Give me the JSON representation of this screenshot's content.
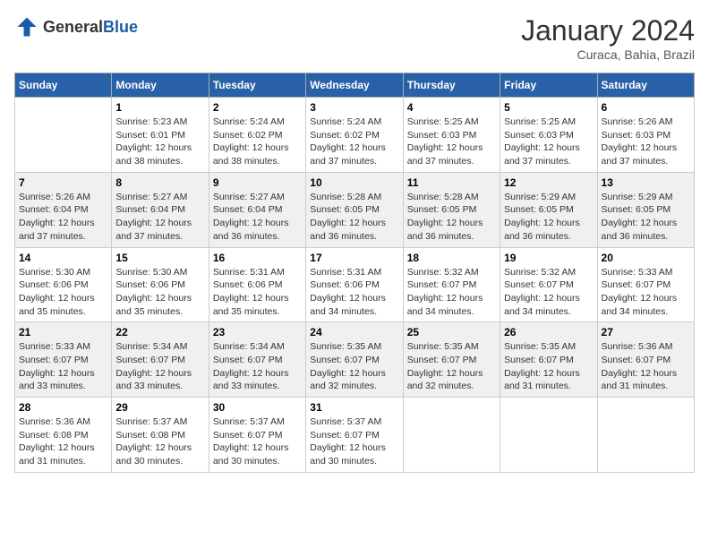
{
  "header": {
    "logo": {
      "general": "General",
      "blue": "Blue"
    },
    "title": "January 2024",
    "location": "Curaca, Bahia, Brazil"
  },
  "days_of_week": [
    "Sunday",
    "Monday",
    "Tuesday",
    "Wednesday",
    "Thursday",
    "Friday",
    "Saturday"
  ],
  "weeks": [
    [
      {
        "day": "",
        "content": ""
      },
      {
        "day": "1",
        "content": "Sunrise: 5:23 AM\nSunset: 6:01 PM\nDaylight: 12 hours\nand 38 minutes."
      },
      {
        "day": "2",
        "content": "Sunrise: 5:24 AM\nSunset: 6:02 PM\nDaylight: 12 hours\nand 38 minutes."
      },
      {
        "day": "3",
        "content": "Sunrise: 5:24 AM\nSunset: 6:02 PM\nDaylight: 12 hours\nand 37 minutes."
      },
      {
        "day": "4",
        "content": "Sunrise: 5:25 AM\nSunset: 6:03 PM\nDaylight: 12 hours\nand 37 minutes."
      },
      {
        "day": "5",
        "content": "Sunrise: 5:25 AM\nSunset: 6:03 PM\nDaylight: 12 hours\nand 37 minutes."
      },
      {
        "day": "6",
        "content": "Sunrise: 5:26 AM\nSunset: 6:03 PM\nDaylight: 12 hours\nand 37 minutes."
      }
    ],
    [
      {
        "day": "7",
        "content": "Sunrise: 5:26 AM\nSunset: 6:04 PM\nDaylight: 12 hours\nand 37 minutes."
      },
      {
        "day": "8",
        "content": "Sunrise: 5:27 AM\nSunset: 6:04 PM\nDaylight: 12 hours\nand 37 minutes."
      },
      {
        "day": "9",
        "content": "Sunrise: 5:27 AM\nSunset: 6:04 PM\nDaylight: 12 hours\nand 36 minutes."
      },
      {
        "day": "10",
        "content": "Sunrise: 5:28 AM\nSunset: 6:05 PM\nDaylight: 12 hours\nand 36 minutes."
      },
      {
        "day": "11",
        "content": "Sunrise: 5:28 AM\nSunset: 6:05 PM\nDaylight: 12 hours\nand 36 minutes."
      },
      {
        "day": "12",
        "content": "Sunrise: 5:29 AM\nSunset: 6:05 PM\nDaylight: 12 hours\nand 36 minutes."
      },
      {
        "day": "13",
        "content": "Sunrise: 5:29 AM\nSunset: 6:05 PM\nDaylight: 12 hours\nand 36 minutes."
      }
    ],
    [
      {
        "day": "14",
        "content": "Sunrise: 5:30 AM\nSunset: 6:06 PM\nDaylight: 12 hours\nand 35 minutes."
      },
      {
        "day": "15",
        "content": "Sunrise: 5:30 AM\nSunset: 6:06 PM\nDaylight: 12 hours\nand 35 minutes."
      },
      {
        "day": "16",
        "content": "Sunrise: 5:31 AM\nSunset: 6:06 PM\nDaylight: 12 hours\nand 35 minutes."
      },
      {
        "day": "17",
        "content": "Sunrise: 5:31 AM\nSunset: 6:06 PM\nDaylight: 12 hours\nand 34 minutes."
      },
      {
        "day": "18",
        "content": "Sunrise: 5:32 AM\nSunset: 6:07 PM\nDaylight: 12 hours\nand 34 minutes."
      },
      {
        "day": "19",
        "content": "Sunrise: 5:32 AM\nSunset: 6:07 PM\nDaylight: 12 hours\nand 34 minutes."
      },
      {
        "day": "20",
        "content": "Sunrise: 5:33 AM\nSunset: 6:07 PM\nDaylight: 12 hours\nand 34 minutes."
      }
    ],
    [
      {
        "day": "21",
        "content": "Sunrise: 5:33 AM\nSunset: 6:07 PM\nDaylight: 12 hours\nand 33 minutes."
      },
      {
        "day": "22",
        "content": "Sunrise: 5:34 AM\nSunset: 6:07 PM\nDaylight: 12 hours\nand 33 minutes."
      },
      {
        "day": "23",
        "content": "Sunrise: 5:34 AM\nSunset: 6:07 PM\nDaylight: 12 hours\nand 33 minutes."
      },
      {
        "day": "24",
        "content": "Sunrise: 5:35 AM\nSunset: 6:07 PM\nDaylight: 12 hours\nand 32 minutes."
      },
      {
        "day": "25",
        "content": "Sunrise: 5:35 AM\nSunset: 6:07 PM\nDaylight: 12 hours\nand 32 minutes."
      },
      {
        "day": "26",
        "content": "Sunrise: 5:35 AM\nSunset: 6:07 PM\nDaylight: 12 hours\nand 31 minutes."
      },
      {
        "day": "27",
        "content": "Sunrise: 5:36 AM\nSunset: 6:07 PM\nDaylight: 12 hours\nand 31 minutes."
      }
    ],
    [
      {
        "day": "28",
        "content": "Sunrise: 5:36 AM\nSunset: 6:08 PM\nDaylight: 12 hours\nand 31 minutes."
      },
      {
        "day": "29",
        "content": "Sunrise: 5:37 AM\nSunset: 6:08 PM\nDaylight: 12 hours\nand 30 minutes."
      },
      {
        "day": "30",
        "content": "Sunrise: 5:37 AM\nSunset: 6:07 PM\nDaylight: 12 hours\nand 30 minutes."
      },
      {
        "day": "31",
        "content": "Sunrise: 5:37 AM\nSunset: 6:07 PM\nDaylight: 12 hours\nand 30 minutes."
      },
      {
        "day": "",
        "content": ""
      },
      {
        "day": "",
        "content": ""
      },
      {
        "day": "",
        "content": ""
      }
    ]
  ]
}
